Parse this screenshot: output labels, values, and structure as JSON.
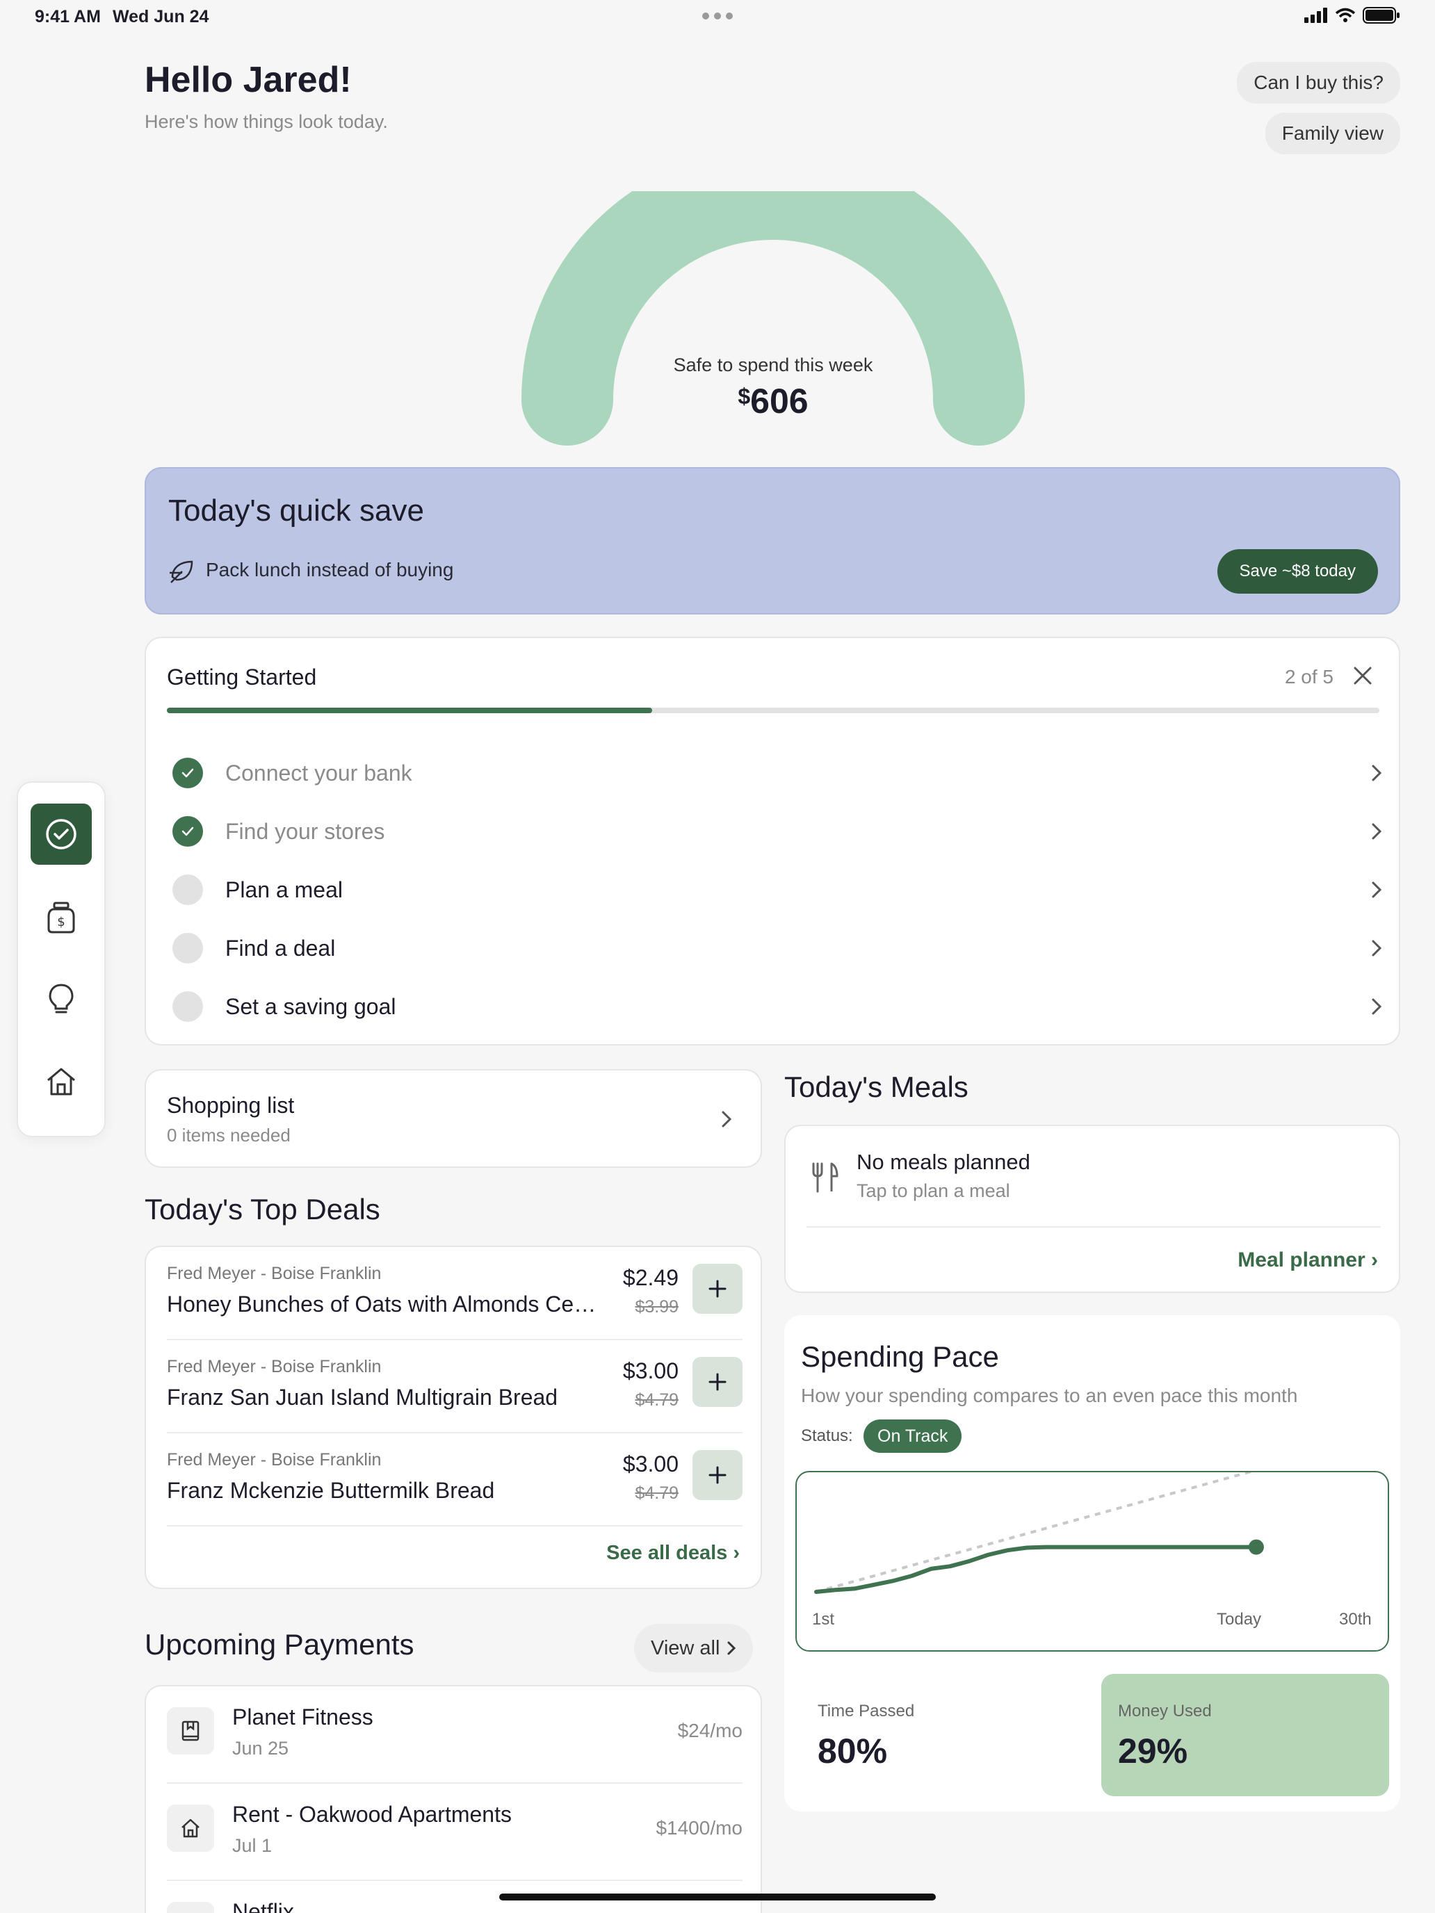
{
  "status_bar": {
    "time": "9:41 AM",
    "date": "Wed Jun 24"
  },
  "header": {
    "greeting": "Hello Jared!",
    "subtitle": "Here's how things look today.",
    "can_i_buy": "Can I buy this?",
    "family_view": "Family view"
  },
  "gauge": {
    "label": "Safe to spend this week",
    "currency": "$",
    "amount": "606",
    "color": "#a9d6bc"
  },
  "quick_save": {
    "title": "Today's quick save",
    "tip": "Pack lunch instead of buying",
    "button": "Save ~$8 today",
    "bg_color": "#bcc5e3"
  },
  "getting_started": {
    "title": "Getting Started",
    "count": "2 of 5",
    "progress": 0.4,
    "items": [
      {
        "label": "Connect your bank",
        "done": true
      },
      {
        "label": "Find your stores",
        "done": true
      },
      {
        "label": "Plan a meal",
        "done": false
      },
      {
        "label": "Find a deal",
        "done": false
      },
      {
        "label": "Set a saving goal",
        "done": false
      }
    ]
  },
  "sidenav": {
    "items": [
      "checklist-icon",
      "money-jar-icon",
      "lightbulb-icon",
      "home-icon"
    ],
    "active": 0
  },
  "shopping_list": {
    "title": "Shopping list",
    "subtitle": "0 items needed"
  },
  "top_deals": {
    "title": "Today's Top Deals",
    "items": [
      {
        "store": "Fred Meyer - Boise Franklin",
        "name": "Honey Bunches of Oats with Almonds Cereal",
        "price": "$2.49",
        "old_price": "$3.99"
      },
      {
        "store": "Fred Meyer - Boise Franklin",
        "name": "Franz San Juan Island Multigrain Bread",
        "price": "$3.00",
        "old_price": "$4.79"
      },
      {
        "store": "Fred Meyer - Boise Franklin",
        "name": "Franz Mckenzie Buttermilk Bread",
        "price": "$3.00",
        "old_price": "$4.79"
      }
    ],
    "see_all": "See all deals"
  },
  "upcoming_payments": {
    "title": "Upcoming Payments",
    "view_all": "View all",
    "items": [
      {
        "name": "Planet Fitness",
        "date": "Jun 25",
        "amount": "$24/mo",
        "icon": "book-icon"
      },
      {
        "name": "Rent - Oakwood Apartments",
        "date": "Jul 1",
        "amount": "$1400/mo",
        "icon": "home-icon"
      },
      {
        "name": "Netflix",
        "date": "",
        "amount": "",
        "icon": "tv-icon"
      }
    ]
  },
  "meals": {
    "title": "Today's Meals",
    "empty_title": "No meals planned",
    "empty_sub": "Tap to plan a meal",
    "planner_link": "Meal planner"
  },
  "spending_pace": {
    "title": "Spending Pace",
    "subtitle": "How your spending compares to an even pace this month",
    "status_label": "Status:",
    "status": "On Track",
    "x_start": "1st",
    "x_today": "Today",
    "x_end": "30th",
    "time_passed_label": "Time Passed",
    "time_passed": "80%",
    "money_used_label": "Money Used",
    "money_used": "29%"
  },
  "chart_data": {
    "type": "line",
    "x": [
      1,
      2,
      3,
      4,
      5,
      6,
      7,
      8,
      9,
      10,
      11,
      12,
      13,
      14,
      15,
      16,
      17,
      18,
      19,
      20,
      21,
      22,
      23,
      24
    ],
    "series": [
      {
        "values": [
          0.0,
          0.6,
          1.0,
          2.2,
          3.4,
          5.0,
          7.2,
          8.0,
          9.6,
          11.6,
          13.0,
          13.8,
          14.0,
          14.0,
          14.0,
          14.0,
          14.0,
          14.0,
          14.0,
          14.0,
          14.0,
          14.0,
          14.0,
          14.0
        ]
      }
    ],
    "pace_line": {
      "x": [
        1,
        30
      ],
      "values": [
        0.0,
        48.0
      ]
    },
    "xlim": [
      1,
      30
    ],
    "x_tick_labels": [
      "1st",
      "Today",
      "30th"
    ],
    "grid": false
  }
}
